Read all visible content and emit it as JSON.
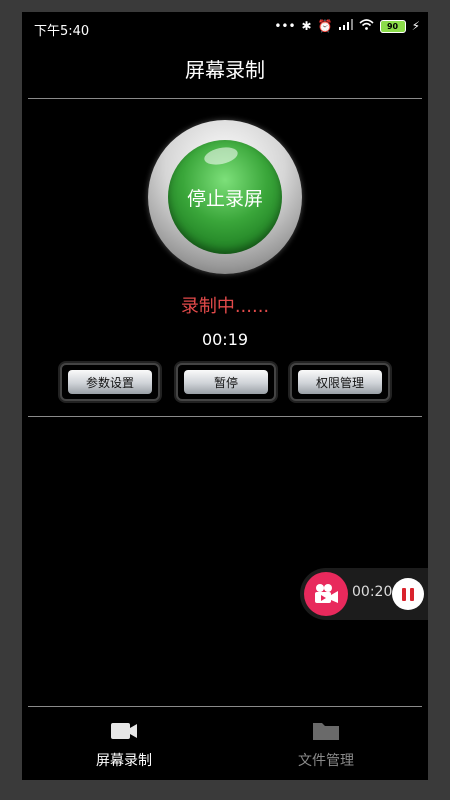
{
  "status_bar": {
    "time": "下午5:40",
    "battery": "90",
    "icons": [
      "more-dots-icon",
      "bluetooth-icon",
      "alarm-icon",
      "signal-icon",
      "wifi-icon",
      "battery-icon",
      "charging-icon"
    ]
  },
  "header": {
    "title": "屏幕录制"
  },
  "record_button": {
    "label": "停止录屏",
    "color": "#3aa63a"
  },
  "recording_status": {
    "text": "录制中......",
    "color": "#e24a4a"
  },
  "timer": "00:19",
  "actions": [
    {
      "label": "参数设置"
    },
    {
      "label": "暂停"
    },
    {
      "label": "权限管理"
    }
  ],
  "floating_widget": {
    "time": "00:20",
    "accent": "#e8295c"
  },
  "bottom_nav": [
    {
      "label": "屏幕录制",
      "icon": "video-camera-icon",
      "active": true
    },
    {
      "label": "文件管理",
      "icon": "folder-icon",
      "active": false
    }
  ]
}
